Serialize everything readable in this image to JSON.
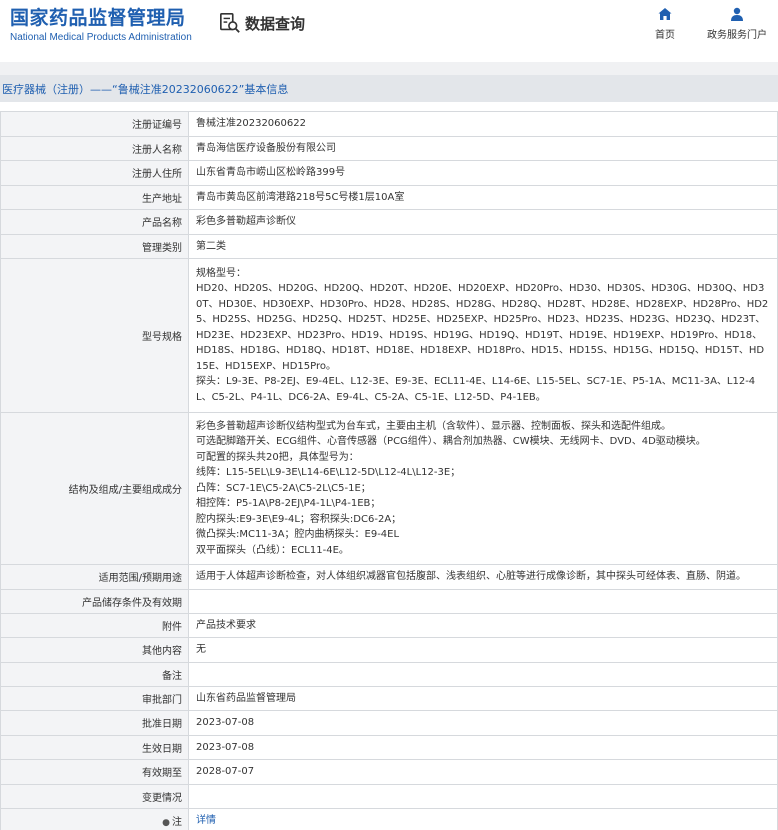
{
  "header": {
    "logo_cn": "国家药品监督管理局",
    "logo_en": "National Medical Products Administration",
    "search_title": "数据查询",
    "nav_home": "首页",
    "nav_service": "政务服务门户"
  },
  "page_title": "医疗器械（注册）——“鲁械注准20232060622”基本信息",
  "rows": {
    "reg_no": {
      "label": "注册证编号",
      "value": "鲁械注准20232060622"
    },
    "registrant": {
      "label": "注册人名称",
      "value": "青岛海信医疗设备股份有限公司"
    },
    "reg_address": {
      "label": "注册人住所",
      "value": "山东省青岛市崂山区松岭路399号"
    },
    "prod_address": {
      "label": "生产地址",
      "value": "青岛市黄岛区前湾港路218号5C号楼1层10A室"
    },
    "product_name": {
      "label": "产品名称",
      "value": "彩色多普勒超声诊断仪"
    },
    "category": {
      "label": "管理类别",
      "value": "第二类"
    },
    "model": {
      "label": "型号规格",
      "line1": "规格型号：",
      "line2": "HD20、HD20S、HD20G、HD20Q、HD20T、HD20E、HD20EXP、HD20Pro、HD30、HD30S、HD30G、HD30Q、HD30T、HD30E、HD30EXP、HD30Pro、HD28、HD28S、HD28G、HD28Q、HD28T、HD28E、HD28EXP、HD28Pro、HD25、HD25S、HD25G、HD25Q、HD25T、HD25E、HD25EXP、HD25Pro、HD23、HD23S、HD23G、HD23Q、HD23T、HD23E、HD23EXP、HD23Pro、HD19、HD19S、HD19G、HD19Q、HD19T、HD19E、HD19EXP、HD19Pro、HD18、HD18S、HD18G、HD18Q、HD18T、HD18E、HD18EXP、HD18Pro、HD15、HD15S、HD15G、HD15Q、HD15T、HD15E、HD15EXP、HD15Pro。",
      "line3": "探头：L9-3E、P8-2EJ、E9-4EL、L12-3E、E9-3E、ECL11-4E、L14-6E、L15-5EL、SC7-1E、P5-1A、MC11-3A、L12-4L、C5-2L、P4-1L、DC6-2A、E9-4L、C5-2A、C5-1E、L12-5D、P4-1EB。"
    },
    "structure": {
      "label": "结构及组成/主要组成成分",
      "lines": [
        "彩色多普勒超声诊断仪结构型式为台车式，主要由主机（含软件）、显示器、控制面板、探头和选配件组成。",
        "可选配脚踏开关、ECG组件、心音传感器（PCG组件）、耦合剂加热器、CW模块、无线网卡、DVD、4D驱动模块。",
        "可配置的探头共20把，具体型号为：",
        "线阵：L15-5EL\\L9-3E\\L14-6E\\L12-5D\\L12-4L\\L12-3E；",
        "凸阵：SC7-1E\\C5-2A\\C5-2L\\C5-1E；",
        "相控阵：P5-1A\\P8-2EJ\\P4-1L\\P4-1EB；",
        "腔内探头:E9-3E\\E9-4L；容积探头:DC6-2A；",
        "微凸探头:MC11-3A；腔内曲柄探头：E9-4EL",
        "双平面探头（凸线）：ECL11-4E。"
      ]
    },
    "scope": {
      "label": "适用范围/预期用途",
      "value": "适用于人体超声诊断检查，对人体组织减器官包括腹部、浅表组织、心脏等进行成像诊断，其中探头可经体表、直肠、阴道。"
    },
    "storage": {
      "label": "产品储存条件及有效期",
      "value": ""
    },
    "attachment": {
      "label": "附件",
      "value": "产品技术要求"
    },
    "other": {
      "label": "其他内容",
      "value": "无"
    },
    "remarks": {
      "label": "备注",
      "value": ""
    },
    "approval_dept": {
      "label": "审批部门",
      "value": "山东省药品监督管理局"
    },
    "approval_date": {
      "label": "批准日期",
      "value": "2023-07-08"
    },
    "effective_date": {
      "label": "生效日期",
      "value": "2023-07-08"
    },
    "valid_until": {
      "label": "有效期至",
      "value": "2028-07-07"
    },
    "change": {
      "label": "变更情况",
      "value": ""
    },
    "note": {
      "label": "注",
      "value": "详情"
    }
  }
}
